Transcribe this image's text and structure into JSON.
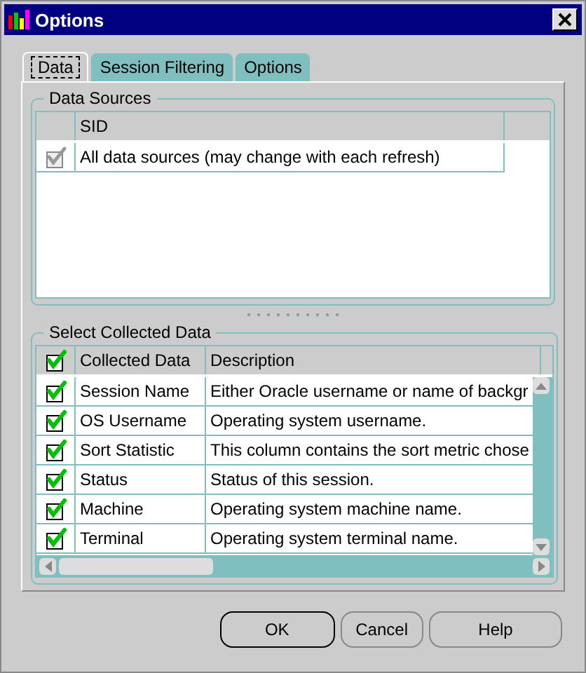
{
  "window": {
    "title": "Options"
  },
  "tabs": [
    {
      "label": "Data",
      "selected": true
    },
    {
      "label": "Session Filtering",
      "selected": false
    },
    {
      "label": "Options",
      "selected": false
    }
  ],
  "data_sources": {
    "title": "Data Sources",
    "columns": [
      "SID"
    ],
    "rows": [
      {
        "checked": true,
        "disabled": true,
        "sid": "All data sources (may change with each refresh)"
      }
    ]
  },
  "collected_data": {
    "title": "Select Collected Data",
    "header_checked": true,
    "columns": [
      "Collected Data",
      "Description"
    ],
    "rows": [
      {
        "checked": true,
        "name": "Session Name",
        "description": "Either Oracle username or name of backgr"
      },
      {
        "checked": true,
        "name": "OS Username",
        "description": "Operating system username."
      },
      {
        "checked": true,
        "name": "Sort Statistic",
        "description": "This column contains the sort metric chose"
      },
      {
        "checked": true,
        "name": "Status",
        "description": "Status of this session."
      },
      {
        "checked": true,
        "name": "Machine",
        "description": "Operating system machine name."
      },
      {
        "checked": true,
        "name": "Terminal",
        "description": "Operating system terminal name."
      }
    ]
  },
  "buttons": [
    {
      "label": "OK",
      "default": true
    },
    {
      "label": "Cancel",
      "default": false
    },
    {
      "label": "Help",
      "default": false
    }
  ]
}
